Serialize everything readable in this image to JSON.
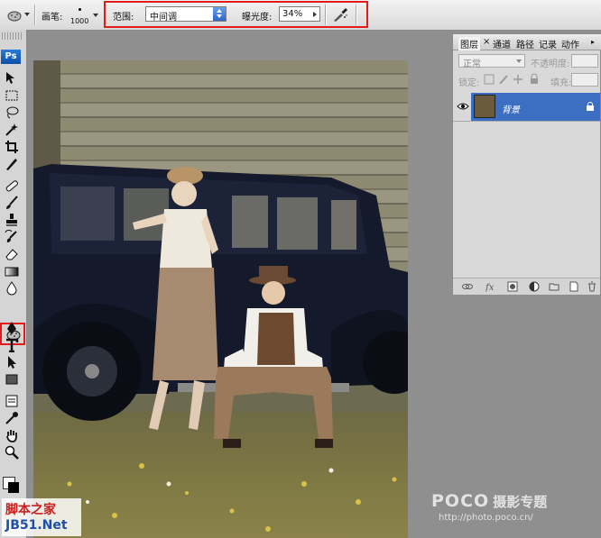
{
  "options_bar": {
    "brush_label": "画笔:",
    "brush_size": "1000",
    "range_label": "范围:",
    "range_value": "中间调",
    "exposure_label": "曝光度:",
    "exposure_value": "34%"
  },
  "toolbox": {
    "logo": "Ps",
    "highlighted_tool": "sponge-tool",
    "foreground_color": "#ffffff",
    "background_color": "#000000"
  },
  "layers_panel": {
    "tabs": [
      "图层",
      "×",
      "通道",
      "路径",
      "记录",
      "动作"
    ],
    "blend_mode": "正常",
    "opacity_label": "不透明度:",
    "lock_label": "锁定:",
    "fill_label": "填充:",
    "layers": [
      {
        "name": "背景",
        "visible": true,
        "locked": true,
        "selected": true
      }
    ]
  },
  "watermarks": {
    "site_line1": "脚本之家",
    "site_line2": "JB51.Net",
    "poco_brand": "POCO",
    "poco_cn": "摄影专题",
    "poco_url": "http://photo.poco.cn/"
  },
  "colors": {
    "highlight_red": "#e21a1a",
    "selection_blue": "#3c6fc2",
    "panel_gray": "#d9d9d9"
  }
}
